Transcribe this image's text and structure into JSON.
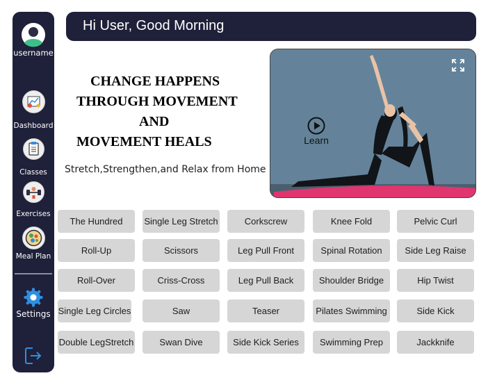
{
  "user": {
    "username": "username"
  },
  "sidebar": {
    "items": [
      {
        "label": "Dashboard",
        "icon": "dashboard-chart-icon"
      },
      {
        "label": "Classes",
        "icon": "clipboard-icon"
      },
      {
        "label": "Exercises",
        "icon": "dumbbell-icon"
      },
      {
        "label": "Meal Plan",
        "icon": "meal-bowl-icon"
      }
    ],
    "settings": {
      "label": "Settings",
      "icon": "gear-icon"
    },
    "logout_icon": "logout-icon"
  },
  "header": {
    "greeting": "Hi User, Good Morning"
  },
  "hero": {
    "headline_lines": [
      "CHANGE HAPPENS",
      "THROUGH MOVEMENT",
      "AND",
      "MOVEMENT HEALS"
    ],
    "subtitle": "Stretch,Strengthen,and Relax from Home"
  },
  "video": {
    "learn_label": "Learn",
    "play_icon": "play-icon",
    "expand_icon": "expand-icon"
  },
  "exercises": [
    [
      "The Hundred",
      "Single Leg Stretch",
      "Corkscrew",
      "Knee Fold",
      "Pelvic Curl"
    ],
    [
      "Roll-Up",
      "Scissors",
      "Leg Pull Front",
      "Spinal Rotation",
      "Side Leg Raise"
    ],
    [
      "Roll-Over",
      "Criss-Cross",
      "Leg Pull Back",
      "Shoulder Bridge",
      "Hip Twist"
    ],
    [
      "Single Leg Circles",
      "Saw",
      "Teaser",
      "Pilates Swimming",
      "Side Kick"
    ],
    [
      "Double LegStretch",
      "Swan Dive",
      "Side Kick Series",
      "Swimming Prep",
      "Jackknife"
    ]
  ],
  "colors": {
    "nav_bg": "#1f2039",
    "pill_bg": "#d6d6d6",
    "accent_blue": "#2f8fe0"
  }
}
